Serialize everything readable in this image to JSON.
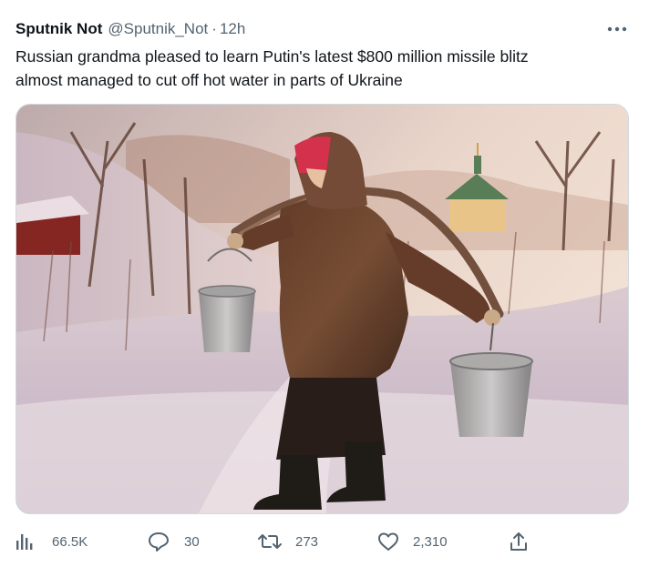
{
  "tweet": {
    "author": {
      "display_name": "Sputnik Not",
      "handle": "@Sputnik_Not",
      "separator": "·",
      "time": "12h"
    },
    "more_icon": "more-horizontal-icon",
    "text_line1": "Russian grandma pleased to learn Putin's latest $800 million missile blitz",
    "text_line2": "almost managed to cut off hot water in parts of Ukraine",
    "stats": {
      "views": "66.5K",
      "replies": "30",
      "retweets": "273",
      "likes": "2,310"
    },
    "icons": [
      "views-icon",
      "reply-icon",
      "retweet-icon",
      "like-icon",
      "share-icon"
    ]
  },
  "colors": {
    "text": "#0f1419",
    "secondary": "#536471",
    "border": "#cfd9de"
  }
}
